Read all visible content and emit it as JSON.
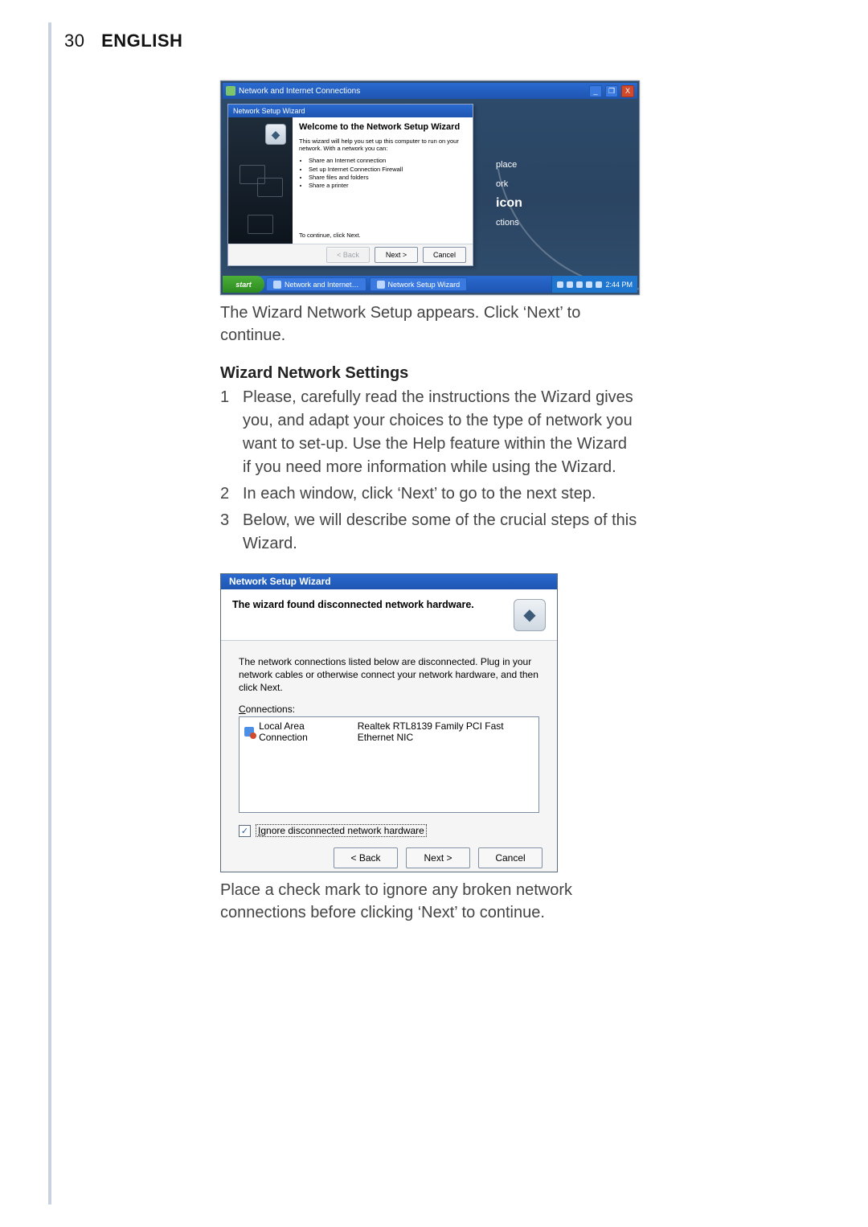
{
  "page": {
    "number": "30",
    "lang": "ENGLISH"
  },
  "fig1": {
    "outer_title": "Network and Internet Connections",
    "winbtn_min": "_",
    "winbtn_max": "❐",
    "winbtn_close": "X",
    "wizard_title": "Network Setup Wizard",
    "heading": "Welcome to the Network Setup Wizard",
    "intro": "This wizard will help you set up this computer to run on your network. With a network you can:",
    "bullets": [
      "Share an Internet connection",
      "Set up Internet Connection Firewall",
      "Share files and folders",
      "Share a printer"
    ],
    "continue_hint": "To continue, click Next.",
    "btn_back": "< Back",
    "btn_next": "Next >",
    "btn_cancel": "Cancel",
    "side_place": "place",
    "side_ork": "ork",
    "side_icon": "icon",
    "side_ctions": "ctions",
    "taskbar": {
      "start": "start",
      "btn1": "Network and Internet…",
      "btn2": "Network Setup Wizard",
      "clock": "2:44 PM"
    }
  },
  "caption1": "The Wizard Network Setup appears. Click ‘Next’ to continue.",
  "section_title": "Wizard Network Settings",
  "steps": [
    "Please, carefully read the instructions the Wizard gives you, and adapt your choices to the type of network you want to set-up. Use the Help feature within the Wizard if you need more information while using the Wizard.",
    "In each window, click ‘Next’ to go to the next step.",
    "Below, we will describe some of the crucial steps of this Wizard."
  ],
  "fig2": {
    "wizard_title": "Network Setup Wizard",
    "header": "The wizard found disconnected network hardware.",
    "desc": "The network connections listed below are disconnected. Plug in your network cables or otherwise connect your network hardware, and then click Next.",
    "connections_label_pre": "C",
    "connections_label_post": "onnections:",
    "conn_name": "Local Area Connection",
    "conn_device": "Realtek RTL8139 Family PCI Fast Ethernet NIC",
    "check_mark": "✓",
    "ignore_pre": "I",
    "ignore_post": "gnore disconnected network hardware",
    "btn_back": "< Back",
    "btn_next": "Next >",
    "btn_cancel": "Cancel"
  },
  "caption2": "Place a check mark to ignore any broken network connections before clicking ‘Next’ to continue."
}
